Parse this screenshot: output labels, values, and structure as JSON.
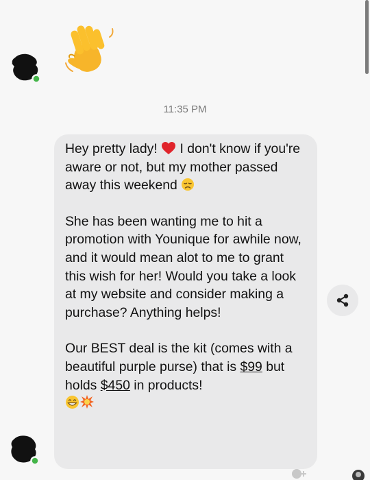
{
  "conversation": {
    "timestamp": "11:35 PM",
    "wave_emoji": "waving-hand-emoji",
    "message": {
      "p1_a": "Hey pretty lady!",
      "p1_b": " I don't know if you're aware or not, but my mother passed away this weekend",
      "p2": "She has been wanting me to hit a promotion with Younique for awhile now, and it would mean alot to me to grant this wish for her! Would you take a look at my website and consider making a purchase? Anything helps!",
      "p3_a": "Our BEST deal is the kit (comes with a beautiful purple purse) that is ",
      "price_1": "$99",
      "p3_b": " but holds ",
      "price_2": "$450",
      "p3_c": " in products!"
    },
    "icons": {
      "heart": "red-heart-emoji",
      "sad": "disappointed-face-emoji",
      "grin": "grinning-face-emoji",
      "burst": "collision-emoji",
      "share": "share-icon"
    },
    "colors": {
      "background": "#f7f7f7",
      "bubble": "#e9e9ea",
      "text": "#121212",
      "timestamp": "#7b7b7b",
      "online": "#44b549",
      "heart": "#e0242b"
    }
  }
}
